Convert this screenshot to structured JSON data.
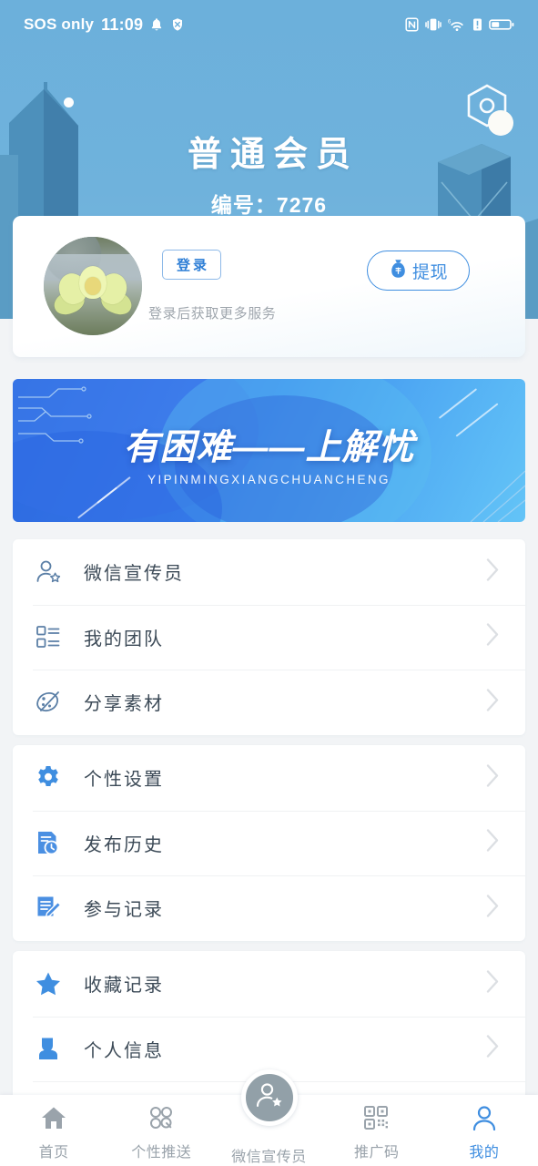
{
  "statusbar": {
    "carrier": "SOS only",
    "time": "11:09",
    "left_icons": [
      "bell-icon",
      "shield-off-icon"
    ],
    "right_icons": [
      "nfc-icon",
      "vibrate-icon",
      "wifi-6-icon",
      "signal-alert-icon",
      "battery-icon"
    ]
  },
  "header": {
    "title": "普通会员",
    "subtitle": "编号：7276",
    "bg_color": "#6cb0db",
    "decoration": "hexagon-badge-icon"
  },
  "login_card": {
    "avatar_alt": "lotus-flower-avatar",
    "login_label": "登录",
    "hint": "登录后获取更多服务",
    "withdraw_label": "提现",
    "withdraw_icon": "money-bag-icon",
    "accent": "#3f8ee0"
  },
  "banner": {
    "title": "有困难——上解忧",
    "subtitle": "YIPINMINGXIANGCHUANCHENG"
  },
  "menu_groups": [
    {
      "items": [
        {
          "icon": "user-star-icon",
          "label": "微信宣传员"
        },
        {
          "icon": "list-squares-icon",
          "label": "我的团队"
        },
        {
          "icon": "share-palette-icon",
          "label": "分享素材"
        }
      ]
    },
    {
      "items": [
        {
          "icon": "gear-icon",
          "label": "个性设置"
        },
        {
          "icon": "document-clock-icon",
          "label": "发布历史"
        },
        {
          "icon": "note-edit-icon",
          "label": "参与记录"
        }
      ]
    },
    {
      "items": [
        {
          "icon": "star-icon",
          "label": "收藏记录"
        },
        {
          "icon": "person-icon",
          "label": "个人信息"
        }
      ]
    }
  ],
  "tabbar": {
    "items": [
      {
        "icon": "home-icon",
        "label": "首页",
        "active": false
      },
      {
        "icon": "circles-icon",
        "label": "个性推送",
        "active": false
      },
      {
        "icon": "user-star-icon",
        "label": "微信宣传员",
        "active": false,
        "center": true
      },
      {
        "icon": "qr-code-icon",
        "label": "推广码",
        "active": false
      },
      {
        "icon": "person-icon",
        "label": "我的",
        "active": true
      }
    ],
    "active_color": "#3f8ee0",
    "inactive_color": "#9aa3ab"
  }
}
